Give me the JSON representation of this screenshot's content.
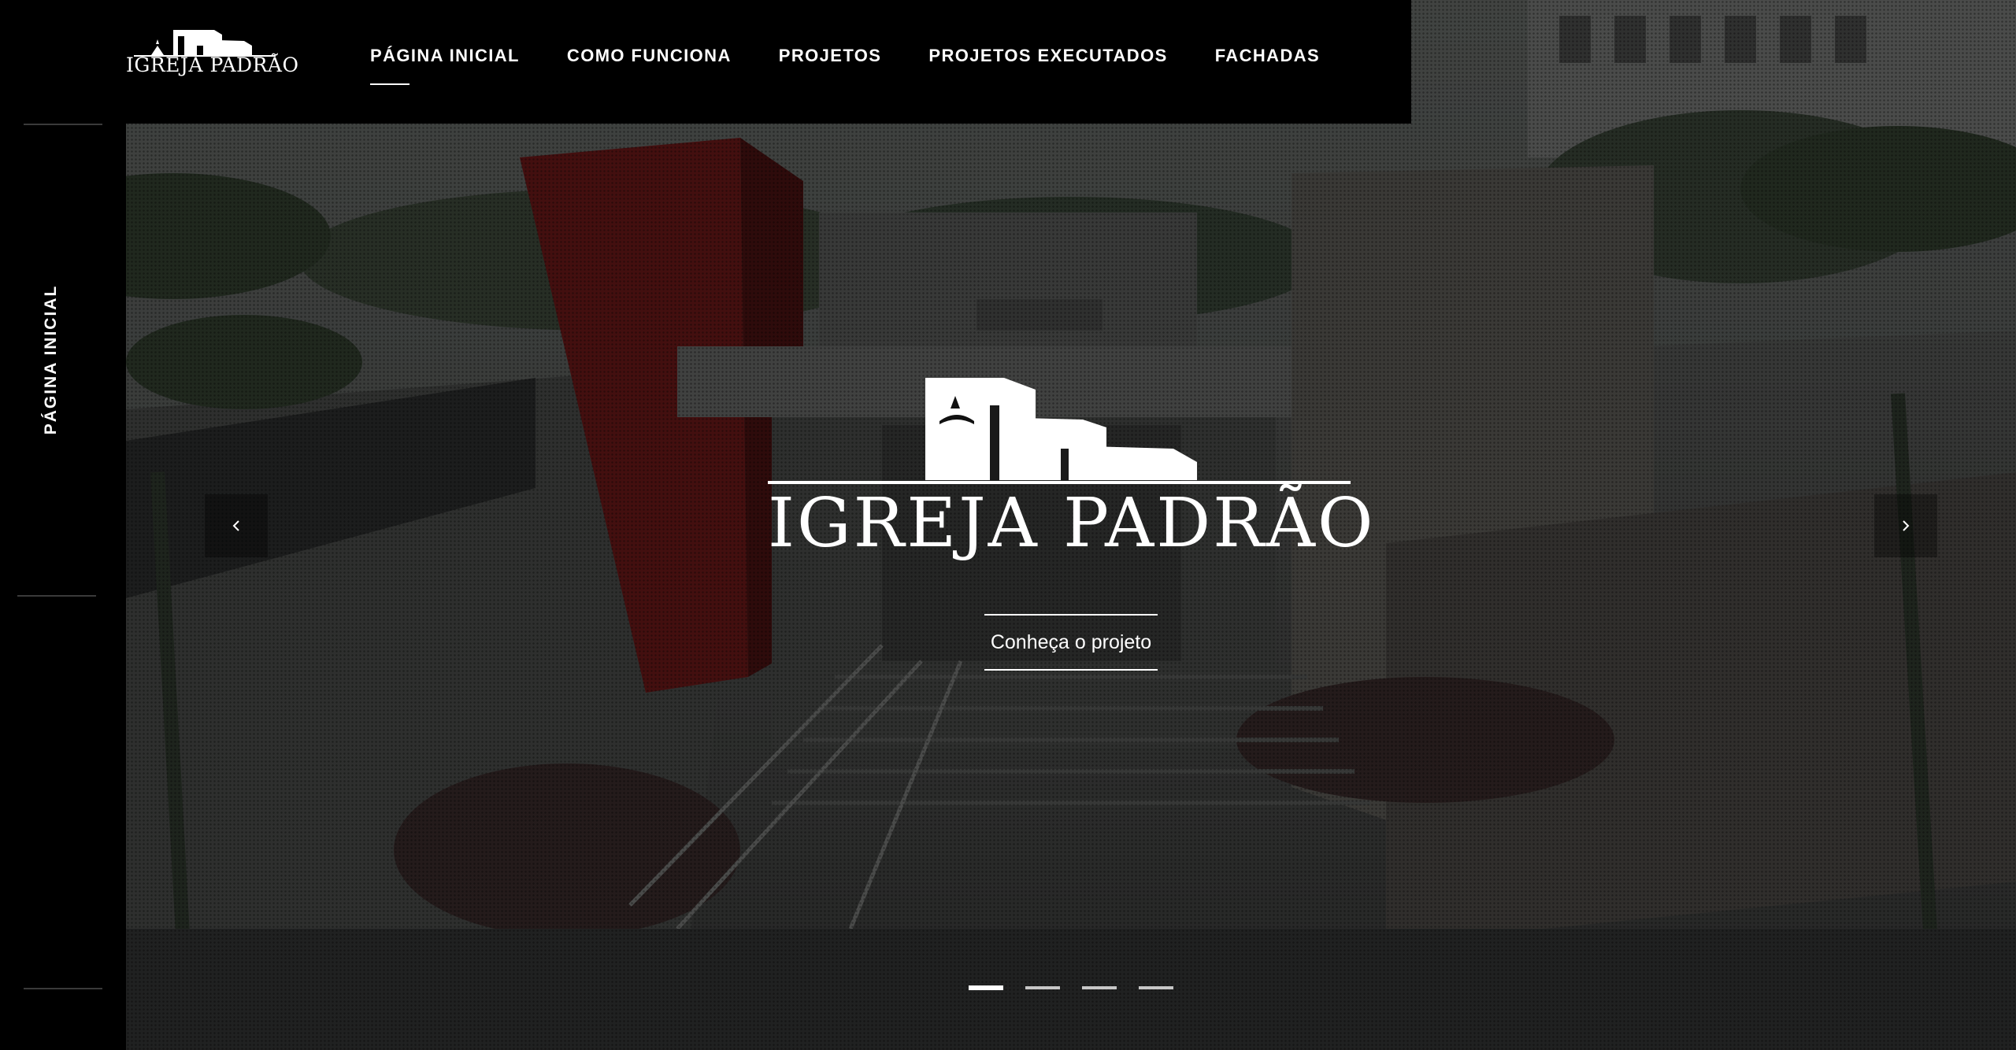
{
  "brand": {
    "logo_text": "IGREJA PADRÃO"
  },
  "nav": {
    "items": [
      {
        "label": "PÁGINA INICIAL",
        "active": true
      },
      {
        "label": "COMO FUNCIONA",
        "active": false
      },
      {
        "label": "PROJETOS",
        "active": false
      },
      {
        "label": "PROJETOS EXECUTADOS",
        "active": false
      },
      {
        "label": "FACHADAS",
        "active": false
      }
    ]
  },
  "sidebar": {
    "current_section": "PÁGINA INICIAL"
  },
  "hero": {
    "title": "IGREJA PADRÃO",
    "cta_label": "Conheça o projeto",
    "slides_total": 4,
    "active_slide": 1,
    "prev_icon": "chevron-left-icon",
    "next_icon": "chevron-right-icon"
  },
  "colors": {
    "background": "#000000",
    "text": "#ffffff",
    "accent_red": "#7a1414"
  }
}
